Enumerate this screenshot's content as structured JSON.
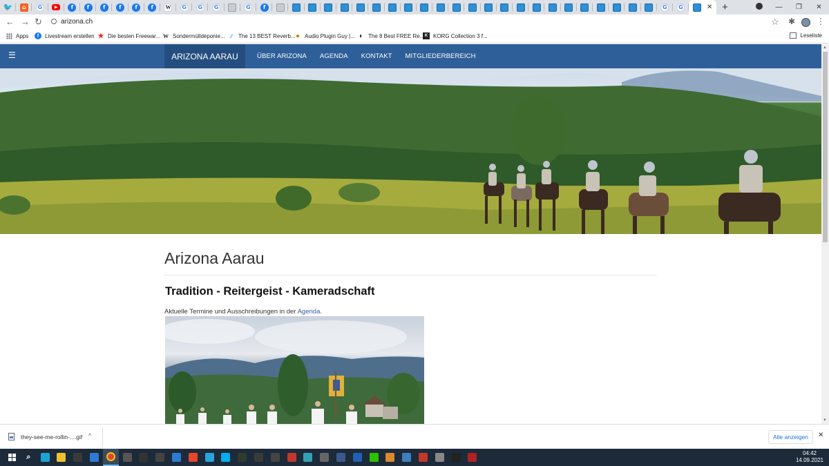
{
  "browser": {
    "tabs": [
      {
        "icon": "twitter-icon",
        "glyph": "🐦",
        "cls": "twitter"
      },
      {
        "icon": "rss-icon",
        "glyph": "⌂",
        "cls": "rss"
      },
      {
        "icon": "google-icon",
        "glyph": "G",
        "cls": "google"
      },
      {
        "icon": "youtube-icon",
        "glyph": "▶",
        "cls": "youtube"
      },
      {
        "icon": "facebook-icon",
        "glyph": "f",
        "cls": "facebook"
      },
      {
        "icon": "facebook-icon",
        "glyph": "f",
        "cls": "facebook"
      },
      {
        "icon": "facebook-icon",
        "glyph": "f",
        "cls": "facebook"
      },
      {
        "icon": "facebook-icon",
        "glyph": "f",
        "cls": "facebook"
      },
      {
        "icon": "facebook-icon",
        "glyph": "f",
        "cls": "facebook"
      },
      {
        "icon": "facebook-icon",
        "glyph": "f",
        "cls": "facebook"
      },
      {
        "icon": "wikipedia-icon",
        "glyph": "W",
        "cls": "wiki"
      },
      {
        "icon": "google-icon",
        "glyph": "G",
        "cls": "google"
      },
      {
        "icon": "google-icon",
        "glyph": "G",
        "cls": "google"
      },
      {
        "icon": "google-icon",
        "glyph": "G",
        "cls": "google"
      },
      {
        "icon": "document-icon",
        "glyph": "",
        "cls": "doc"
      },
      {
        "icon": "google-icon",
        "glyph": "G",
        "cls": "google"
      },
      {
        "icon": "facebook-icon",
        "glyph": "f",
        "cls": "facebook"
      },
      {
        "icon": "document-icon",
        "glyph": "",
        "cls": "doc"
      },
      {
        "icon": "website-icon",
        "glyph": "",
        "cls": "site"
      },
      {
        "icon": "website-icon",
        "glyph": "",
        "cls": "site"
      },
      {
        "icon": "website-icon",
        "glyph": "",
        "cls": "site"
      },
      {
        "icon": "website-icon",
        "glyph": "",
        "cls": "site"
      },
      {
        "icon": "website-icon",
        "glyph": "",
        "cls": "site"
      },
      {
        "icon": "website-icon",
        "glyph": "",
        "cls": "site"
      },
      {
        "icon": "website-icon",
        "glyph": "",
        "cls": "site"
      },
      {
        "icon": "website-icon",
        "glyph": "",
        "cls": "site"
      },
      {
        "icon": "website-icon",
        "glyph": "",
        "cls": "site"
      },
      {
        "icon": "website-icon",
        "glyph": "",
        "cls": "site"
      },
      {
        "icon": "website-icon",
        "glyph": "",
        "cls": "site"
      },
      {
        "icon": "website-icon",
        "glyph": "",
        "cls": "site"
      },
      {
        "icon": "website-icon",
        "glyph": "",
        "cls": "site"
      },
      {
        "icon": "website-icon",
        "glyph": "",
        "cls": "site"
      },
      {
        "icon": "website-icon",
        "glyph": "",
        "cls": "site"
      },
      {
        "icon": "website-icon",
        "glyph": "",
        "cls": "site"
      },
      {
        "icon": "website-icon",
        "glyph": "",
        "cls": "site"
      },
      {
        "icon": "website-icon",
        "glyph": "",
        "cls": "site"
      },
      {
        "icon": "website-icon",
        "glyph": "",
        "cls": "site"
      },
      {
        "icon": "website-icon",
        "glyph": "",
        "cls": "site"
      },
      {
        "icon": "website-icon",
        "glyph": "",
        "cls": "site"
      },
      {
        "icon": "website-icon",
        "glyph": "",
        "cls": "site"
      },
      {
        "icon": "website-icon",
        "glyph": "",
        "cls": "site"
      },
      {
        "icon": "google-icon",
        "glyph": "G",
        "cls": "google"
      },
      {
        "icon": "google-icon",
        "glyph": "G",
        "cls": "google"
      }
    ],
    "active_tab_close": "✕",
    "new_tab": "+",
    "window_controls": {
      "minimize": "—",
      "maximize": "❐",
      "close": "✕"
    },
    "url": "arizona.ch",
    "nav": {
      "back": "←",
      "forward": "→",
      "reload": "↻"
    },
    "bookmarks": [
      {
        "label": "Apps",
        "icon": "apps-grid-icon",
        "cls": "apps"
      },
      {
        "label": "Livestream erstellen",
        "icon": "facebook-icon",
        "cls": "fb",
        "glyph": "f"
      },
      {
        "label": "Die besten Freewar...",
        "icon": "star-icon",
        "cls": "starred",
        "glyph": "★"
      },
      {
        "label": "Sondermülldeponie...",
        "icon": "wikipedia-icon",
        "cls": "wiki",
        "glyph": "W"
      },
      {
        "label": "The 13 BEST Reverb...",
        "icon": "reverb-icon",
        "cls": "reverb",
        "glyph": "∕∕"
      },
      {
        "label": "Audio Plugin Guy |...",
        "icon": "plugin-icon",
        "cls": "plugin",
        "glyph": "●"
      },
      {
        "label": "The 8 Best FREE Re...",
        "icon": "moon-icon",
        "cls": "moon",
        "glyph": "◐"
      },
      {
        "label": "KORG Collection 3 f...",
        "icon": "korg-icon",
        "cls": "korg",
        "glyph": "K"
      }
    ],
    "reading_list": "Leseliste"
  },
  "site": {
    "brand": "ARIZONA AARAU",
    "menu_icon": "☰",
    "nav_links": [
      "ÜBER ARIZONA",
      "AGENDA",
      "KONTAKT",
      "MITGLIEDERBEREICH"
    ],
    "page_title": "Arizona Aarau",
    "subtitle": "Tradition - Reitergeist - Kameradschaft",
    "intro_prefix": "Aktuelle Termine und Ausschreibungen in der ",
    "intro_link": "Agenda",
    "intro_suffix": "."
  },
  "download_bar": {
    "file_name": "they-see-me-rollin-....gif",
    "show_all": "Alle anzeigen",
    "close": "✕",
    "chevron": "^"
  },
  "taskbar": {
    "time": "04:42",
    "date": "14.09.2021",
    "apps": [
      {
        "name": "windows-start-icon",
        "color": ""
      },
      {
        "name": "search-icon",
        "color": "",
        "glyph": "⌕"
      },
      {
        "name": "edge-icon",
        "color": "#1aa5d6"
      },
      {
        "name": "file-explorer-icon",
        "color": "#f0c030"
      },
      {
        "name": "store-icon",
        "color": "#3a3a3a"
      },
      {
        "name": "mail-icon",
        "color": "#2f7bd4"
      },
      {
        "name": "chrome-icon",
        "color": "#db4437"
      },
      {
        "name": "game-icon",
        "color": "#555"
      },
      {
        "name": "inkscape-icon",
        "color": "#333"
      },
      {
        "name": "live-icon",
        "color": "#444"
      },
      {
        "name": "onedrive-icon",
        "color": "#2b7cd3"
      },
      {
        "name": "app-red-icon",
        "color": "#e8452c"
      },
      {
        "name": "telegram-icon",
        "color": "#2aa3dd"
      },
      {
        "name": "skype-icon",
        "color": "#00aff0"
      },
      {
        "name": "calculator-icon",
        "color": "#2e3b2e"
      },
      {
        "name": "keyboard-icon",
        "color": "#3a3a3a"
      },
      {
        "name": "tools-icon",
        "color": "#444"
      },
      {
        "name": "video-icon",
        "color": "#c0392b"
      },
      {
        "name": "app-teal-icon",
        "color": "#35a0b5"
      },
      {
        "name": "app-grey-icon",
        "color": "#666"
      },
      {
        "name": "cube-icon",
        "color": "#3a5a8a"
      },
      {
        "name": "app-blue-icon",
        "color": "#2060b0"
      },
      {
        "name": "wechat-icon",
        "color": "#2dc100"
      },
      {
        "name": "app-orange-icon",
        "color": "#d98a2b"
      },
      {
        "name": "photo-icon",
        "color": "#3d7fbf"
      },
      {
        "name": "pdf-icon",
        "color": "#c0392b"
      },
      {
        "name": "notes-icon",
        "color": "#888"
      },
      {
        "name": "terminal-icon",
        "color": "#222"
      },
      {
        "name": "app-red2-icon",
        "color": "#b22222"
      }
    ]
  }
}
